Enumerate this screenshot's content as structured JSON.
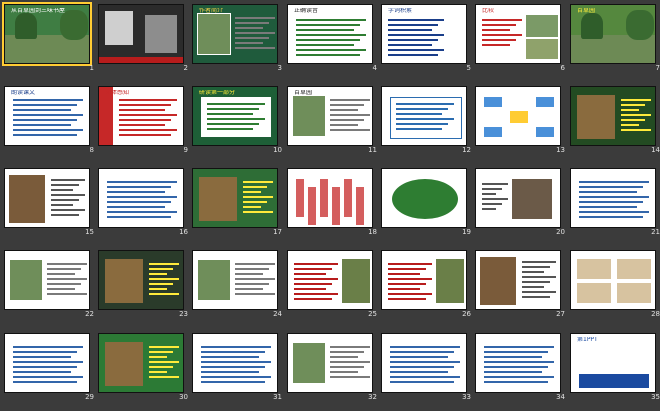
{
  "window_title": "",
  "selected_slide": 1,
  "slides": [
    {
      "n": "1",
      "bg": "#3f7d43",
      "title": "从百草园到三味书屋",
      "title_color": "#ffffff",
      "variant": "photo"
    },
    {
      "n": "2",
      "bg": "#2b2b2b",
      "title": "",
      "title_color": "#ffffff",
      "variant": "portraits"
    },
    {
      "n": "3",
      "bg": "#1f5b3c",
      "title": "作者简介",
      "title_color": "#ffd54a",
      "variant": "photo-left"
    },
    {
      "n": "4",
      "bg": "#ffffff",
      "title": "正确读音",
      "title_color": "#222",
      "variant": "notes"
    },
    {
      "n": "5",
      "bg": "#ffffff",
      "title": "字词积累",
      "title_color": "#1a3e8a",
      "variant": "words"
    },
    {
      "n": "6",
      "bg": "#ffffff",
      "title": "比较",
      "title_color": "#c62828",
      "variant": "compare"
    },
    {
      "n": "7",
      "bg": "#55883e",
      "title": "百草园",
      "title_color": "#ffeb3b",
      "variant": "photo"
    },
    {
      "n": "8",
      "bg": "#ffffff",
      "title": "朗读课文",
      "title_color": "#1a3e8a",
      "variant": "plain"
    },
    {
      "n": "9",
      "bg": "#ffffff",
      "title": "整体感知",
      "title_color": "#c62828",
      "variant": "red-side"
    },
    {
      "n": "10",
      "bg": "#1e5f37",
      "title": "研读第一部分",
      "title_color": "#ffeb3b",
      "variant": "green-box"
    },
    {
      "n": "11",
      "bg": "#ffffff",
      "title": "百草园",
      "title_color": "#222",
      "variant": "photo-left"
    },
    {
      "n": "12",
      "bg": "#ffffff",
      "title": "",
      "title_color": "#222",
      "variant": "flow"
    },
    {
      "n": "13",
      "bg": "#ffffff",
      "title": "",
      "title_color": "#222",
      "variant": "diagram"
    },
    {
      "n": "14",
      "bg": "#234b22",
      "title": "",
      "title_color": "#fff",
      "variant": "green-photo"
    },
    {
      "n": "15",
      "bg": "#ffffff",
      "title": "",
      "title_color": "#222",
      "variant": "photo-strip"
    },
    {
      "n": "16",
      "bg": "#ffffff",
      "title": "",
      "title_color": "#222",
      "variant": "text"
    },
    {
      "n": "17",
      "bg": "#2e6d36",
      "title": "",
      "title_color": "#fff",
      "variant": "green-photo"
    },
    {
      "n": "18",
      "bg": "#ffffff",
      "title": "",
      "title_color": "#222",
      "variant": "chars"
    },
    {
      "n": "19",
      "bg": "#ffffff",
      "title": "",
      "title_color": "#222",
      "variant": "snake"
    },
    {
      "n": "20",
      "bg": "#ffffff",
      "title": "",
      "title_color": "#222",
      "variant": "house"
    },
    {
      "n": "21",
      "bg": "#ffffff",
      "title": "",
      "title_color": "#222",
      "variant": "text"
    },
    {
      "n": "22",
      "bg": "#ffffff",
      "title": "",
      "title_color": "#222",
      "variant": "photo-left"
    },
    {
      "n": "23",
      "bg": "#2a3b2a",
      "title": "",
      "title_color": "#fff",
      "variant": "green-photo"
    },
    {
      "n": "24",
      "bg": "#ffffff",
      "title": "",
      "title_color": "#222",
      "variant": "photo-left"
    },
    {
      "n": "25",
      "bg": "#ffffff",
      "title": "",
      "title_color": "#222",
      "variant": "photo-right"
    },
    {
      "n": "26",
      "bg": "#ffffff",
      "title": "",
      "title_color": "#222",
      "variant": "photo-right"
    },
    {
      "n": "27",
      "bg": "#ffffff",
      "title": "",
      "title_color": "#222",
      "variant": "photo-strip"
    },
    {
      "n": "28",
      "bg": "#ffffff",
      "title": "",
      "title_color": "#222",
      "variant": "grid"
    },
    {
      "n": "29",
      "bg": "#ffffff",
      "title": "",
      "title_color": "#222",
      "variant": "text"
    },
    {
      "n": "30",
      "bg": "#2c7a35",
      "title": "",
      "title_color": "#fff",
      "variant": "green-photo"
    },
    {
      "n": "31",
      "bg": "#ffffff",
      "title": "",
      "title_color": "#222",
      "variant": "text"
    },
    {
      "n": "32",
      "bg": "#ffffff",
      "title": "",
      "title_color": "#222",
      "variant": "photo-left"
    },
    {
      "n": "33",
      "bg": "#ffffff",
      "title": "",
      "title_color": "#222",
      "variant": "text"
    },
    {
      "n": "34",
      "bg": "#ffffff",
      "title": "",
      "title_color": "#222",
      "variant": "text"
    },
    {
      "n": "35",
      "bg": "#ffffff",
      "title": "第1PPT",
      "title_color": "#1a4aa0",
      "variant": "brand"
    }
  ]
}
